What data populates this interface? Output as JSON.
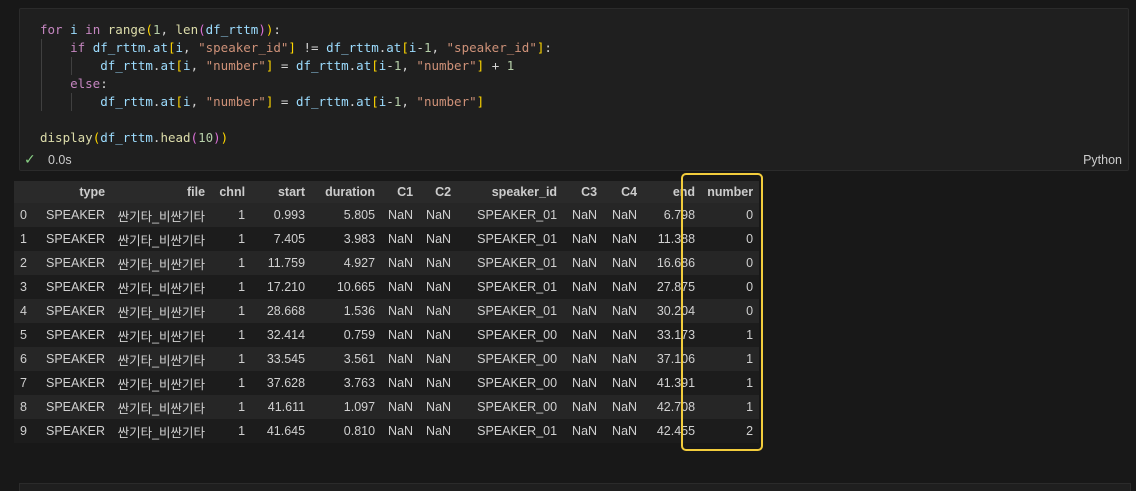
{
  "cell": {
    "language": "Python",
    "exec_time": "0.0s",
    "status_icon": "check-icon"
  },
  "code_lines": [
    [
      [
        "kw",
        "for"
      ],
      [
        "op",
        " "
      ],
      [
        "var",
        "i"
      ],
      [
        "op",
        " "
      ],
      [
        "kw",
        "in"
      ],
      [
        "op",
        " "
      ],
      [
        "fn",
        "range"
      ],
      [
        "br1",
        "("
      ],
      [
        "num",
        "1"
      ],
      [
        "op",
        ", "
      ],
      [
        "fn",
        "len"
      ],
      [
        "br2",
        "("
      ],
      [
        "var",
        "df_rttm"
      ],
      [
        "br2",
        ")"
      ],
      [
        "br1",
        ")"
      ],
      [
        "op",
        ":"
      ]
    ],
    [
      [
        "op",
        "    "
      ],
      [
        "kw",
        "if"
      ],
      [
        "op",
        " "
      ],
      [
        "var",
        "df_rttm"
      ],
      [
        "op",
        "."
      ],
      [
        "var",
        "at"
      ],
      [
        "br1",
        "["
      ],
      [
        "var",
        "i"
      ],
      [
        "op",
        ", "
      ],
      [
        "str",
        "\"speaker_id\""
      ],
      [
        "br1",
        "]"
      ],
      [
        "op",
        " != "
      ],
      [
        "var",
        "df_rttm"
      ],
      [
        "op",
        "."
      ],
      [
        "var",
        "at"
      ],
      [
        "br1",
        "["
      ],
      [
        "var",
        "i"
      ],
      [
        "op",
        "-"
      ],
      [
        "num",
        "1"
      ],
      [
        "op",
        ", "
      ],
      [
        "str",
        "\"speaker_id\""
      ],
      [
        "br1",
        "]"
      ],
      [
        "op",
        ":"
      ]
    ],
    [
      [
        "op",
        "        "
      ],
      [
        "var",
        "df_rttm"
      ],
      [
        "op",
        "."
      ],
      [
        "var",
        "at"
      ],
      [
        "br1",
        "["
      ],
      [
        "var",
        "i"
      ],
      [
        "op",
        ", "
      ],
      [
        "str",
        "\"number\""
      ],
      [
        "br1",
        "]"
      ],
      [
        "op",
        " = "
      ],
      [
        "var",
        "df_rttm"
      ],
      [
        "op",
        "."
      ],
      [
        "var",
        "at"
      ],
      [
        "br1",
        "["
      ],
      [
        "var",
        "i"
      ],
      [
        "op",
        "-"
      ],
      [
        "num",
        "1"
      ],
      [
        "op",
        ", "
      ],
      [
        "str",
        "\"number\""
      ],
      [
        "br1",
        "]"
      ],
      [
        "op",
        " + "
      ],
      [
        "num",
        "1"
      ]
    ],
    [
      [
        "op",
        "    "
      ],
      [
        "kw",
        "else"
      ],
      [
        "op",
        ":"
      ]
    ],
    [
      [
        "op",
        "        "
      ],
      [
        "var",
        "df_rttm"
      ],
      [
        "op",
        "."
      ],
      [
        "var",
        "at"
      ],
      [
        "br1",
        "["
      ],
      [
        "var",
        "i"
      ],
      [
        "op",
        ", "
      ],
      [
        "str",
        "\"number\""
      ],
      [
        "br1",
        "]"
      ],
      [
        "op",
        " = "
      ],
      [
        "var",
        "df_rttm"
      ],
      [
        "op",
        "."
      ],
      [
        "var",
        "at"
      ],
      [
        "br1",
        "["
      ],
      [
        "var",
        "i"
      ],
      [
        "op",
        "-"
      ],
      [
        "num",
        "1"
      ],
      [
        "op",
        ", "
      ],
      [
        "str",
        "\"number\""
      ],
      [
        "br1",
        "]"
      ]
    ],
    [],
    [
      [
        "fn",
        "display"
      ],
      [
        "br1",
        "("
      ],
      [
        "var",
        "df_rttm"
      ],
      [
        "op",
        "."
      ],
      [
        "fn",
        "head"
      ],
      [
        "br2",
        "("
      ],
      [
        "num",
        "10"
      ],
      [
        "br2",
        ")"
      ],
      [
        "br1",
        ")"
      ]
    ]
  ],
  "table": {
    "columns": [
      "",
      "type",
      "file",
      "chnl",
      "start",
      "duration",
      "C1",
      "C2",
      "speaker_id",
      "C3",
      "C4",
      "end",
      "number"
    ],
    "rows": [
      [
        "0",
        "SPEAKER",
        "싼기타_비싼기타",
        "1",
        "0.993",
        "5.805",
        "NaN",
        "NaN",
        "SPEAKER_01",
        "NaN",
        "NaN",
        "6.798",
        "0"
      ],
      [
        "1",
        "SPEAKER",
        "싼기타_비싼기타",
        "1",
        "7.405",
        "3.983",
        "NaN",
        "NaN",
        "SPEAKER_01",
        "NaN",
        "NaN",
        "11.388",
        "0"
      ],
      [
        "2",
        "SPEAKER",
        "싼기타_비싼기타",
        "1",
        "11.759",
        "4.927",
        "NaN",
        "NaN",
        "SPEAKER_01",
        "NaN",
        "NaN",
        "16.686",
        "0"
      ],
      [
        "3",
        "SPEAKER",
        "싼기타_비싼기타",
        "1",
        "17.210",
        "10.665",
        "NaN",
        "NaN",
        "SPEAKER_01",
        "NaN",
        "NaN",
        "27.875",
        "0"
      ],
      [
        "4",
        "SPEAKER",
        "싼기타_비싼기타",
        "1",
        "28.668",
        "1.536",
        "NaN",
        "NaN",
        "SPEAKER_01",
        "NaN",
        "NaN",
        "30.204",
        "0"
      ],
      [
        "5",
        "SPEAKER",
        "싼기타_비싼기타",
        "1",
        "32.414",
        "0.759",
        "NaN",
        "NaN",
        "SPEAKER_00",
        "NaN",
        "NaN",
        "33.173",
        "1"
      ],
      [
        "6",
        "SPEAKER",
        "싼기타_비싼기타",
        "1",
        "33.545",
        "3.561",
        "NaN",
        "NaN",
        "SPEAKER_00",
        "NaN",
        "NaN",
        "37.106",
        "1"
      ],
      [
        "7",
        "SPEAKER",
        "싼기타_비싼기타",
        "1",
        "37.628",
        "3.763",
        "NaN",
        "NaN",
        "SPEAKER_00",
        "NaN",
        "NaN",
        "41.391",
        "1"
      ],
      [
        "8",
        "SPEAKER",
        "싼기타_비싼기타",
        "1",
        "41.611",
        "1.097",
        "NaN",
        "NaN",
        "SPEAKER_00",
        "NaN",
        "NaN",
        "42.708",
        "1"
      ],
      [
        "9",
        "SPEAKER",
        "싼기타_비싼기타",
        "1",
        "41.645",
        "0.810",
        "NaN",
        "NaN",
        "SPEAKER_01",
        "NaN",
        "NaN",
        "42.455",
        "2"
      ]
    ]
  },
  "colors": {
    "highlight": "#f2cc3c",
    "check": "#89d185"
  }
}
